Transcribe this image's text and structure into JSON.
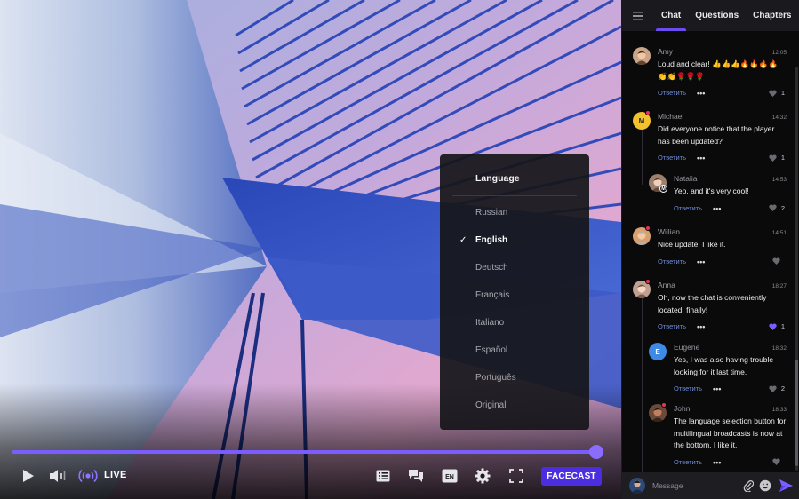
{
  "player": {
    "live_label": "LIVE",
    "progress_fraction": 0.99,
    "brand_label": "FACECAST",
    "controls": [
      "play-icon",
      "volume-icon",
      "live-broadcast-icon",
      "chat-list-icon",
      "comments-icon",
      "language-icon",
      "settings-icon",
      "fullscreen-icon"
    ],
    "language_badge": "EN"
  },
  "language_menu": {
    "header": "Language",
    "options": [
      {
        "label": "Russian",
        "selected": false
      },
      {
        "label": "English",
        "selected": true
      },
      {
        "label": "Deutsch",
        "selected": false
      },
      {
        "label": "Français",
        "selected": false
      },
      {
        "label": "Italiano",
        "selected": false
      },
      {
        "label": "Español",
        "selected": false
      },
      {
        "label": "Português",
        "selected": false
      },
      {
        "label": "Original",
        "selected": false
      }
    ]
  },
  "panel": {
    "tabs": [
      {
        "label": "Chat",
        "active": true
      },
      {
        "label": "Questions",
        "active": false
      },
      {
        "label": "Chapters",
        "active": false
      }
    ],
    "reply_label": "Ответить",
    "messages": [
      {
        "name": "Amy",
        "time": "12:05",
        "text": "Loud and clear! 👍👍👍🔥🔥🔥🔥👏👏🌹🌹🌹",
        "likes": "1",
        "liked": false
      },
      {
        "name": "Michael",
        "time": "14:32",
        "text": "Did everyone notice that the player has been updated?",
        "likes": "1",
        "liked": false,
        "avatar_letter": "M"
      },
      {
        "name": "Natalia",
        "time": "14:53",
        "text": "Yep, and it's very cool!",
        "likes": "2",
        "liked": false,
        "badge_letter": "M"
      },
      {
        "name": "Willian",
        "time": "14:51",
        "text": "Nice update, I like it.",
        "likes": "",
        "liked": false
      },
      {
        "name": "Anna",
        "time": "18:27",
        "text": "Oh, now the chat is conveniently located, finally!",
        "likes": "1",
        "liked": true
      },
      {
        "name": "Eugene",
        "time": "18:32",
        "text": "Yes, I was also having trouble looking for it last time.",
        "likes": "2",
        "liked": false,
        "avatar_letter": "E"
      },
      {
        "name": "John",
        "time": "18:33",
        "text": "The language selection button for multilingual broadcasts is now at the bottom, I like it.",
        "likes": "",
        "liked": false
      }
    ],
    "composer_placeholder": "Message"
  },
  "colors": {
    "accent": "#6a4cf0",
    "brand_button": "#4a2ee0",
    "link": "#6f8bd8",
    "liked_heart": "#7b5cff",
    "notification_dot": "#e6335a"
  }
}
